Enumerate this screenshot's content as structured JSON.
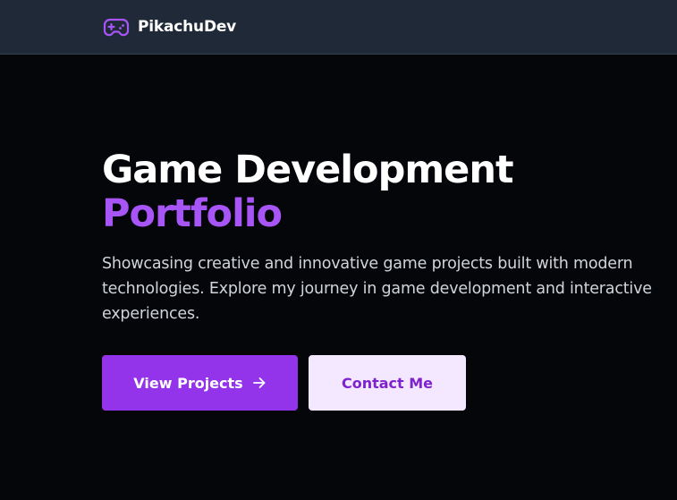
{
  "navbar": {
    "brand_name": "PikachuDev",
    "brand_icon": "gamepad-icon"
  },
  "hero": {
    "title_line1": "Game Development",
    "title_line2": "Portfolio",
    "description": "Showcasing creative and innovative game projects built with modern technologies. Explore my journey in game development and interactive experiences."
  },
  "actions": {
    "primary_label": "View Projects",
    "primary_icon": "arrow-right-icon",
    "secondary_label": "Contact Me"
  },
  "colors": {
    "background": "#05060a",
    "navbar": "#1f2937",
    "accent": "#a855f7",
    "primary_button": "#9333ea",
    "secondary_button": "#f3e8ff",
    "secondary_text": "#7e22ce"
  }
}
